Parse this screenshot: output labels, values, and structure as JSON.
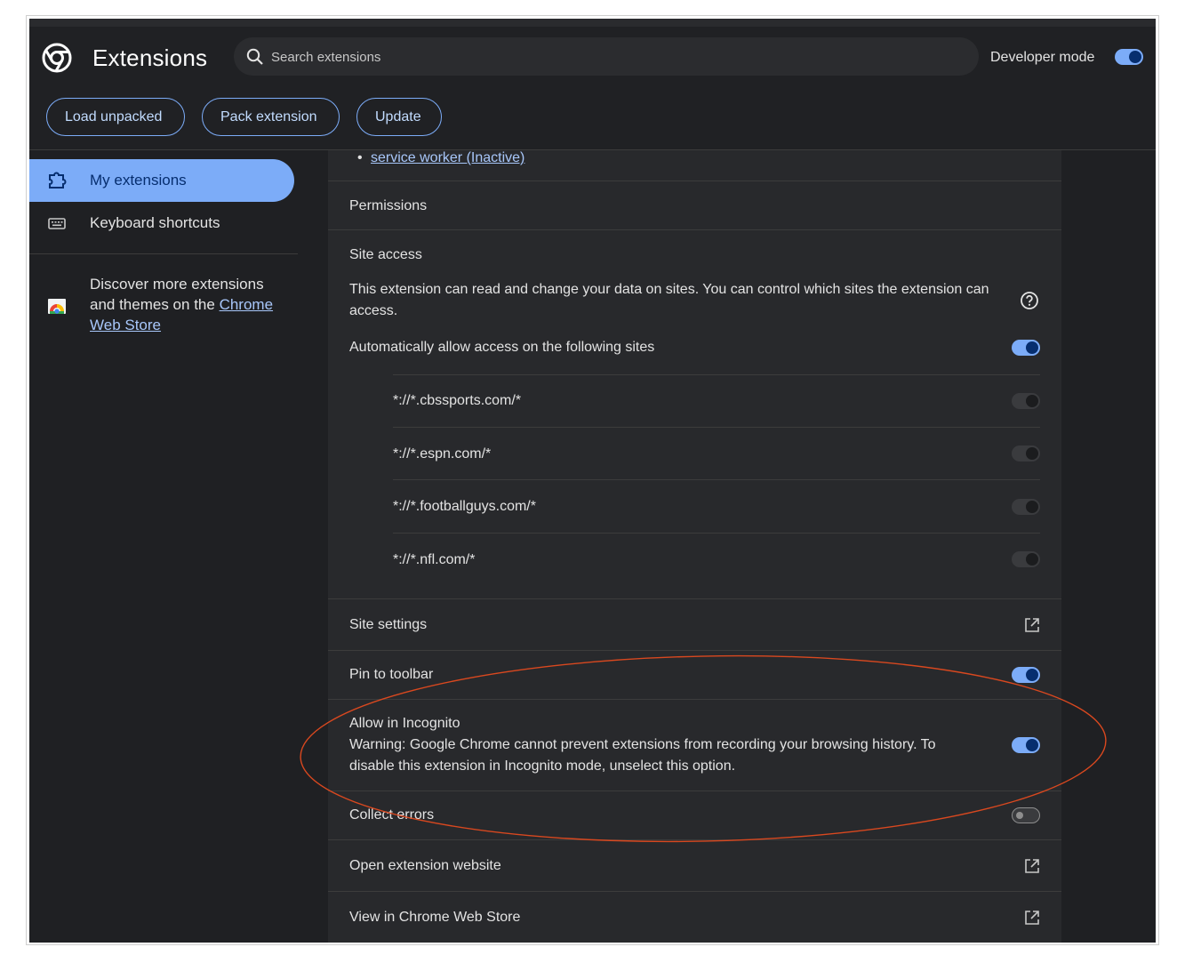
{
  "header": {
    "title": "Extensions",
    "search_placeholder": "Search extensions",
    "developer_mode_label": "Developer mode",
    "developer_mode_on": true
  },
  "toolbar": {
    "load_unpacked": "Load unpacked",
    "pack_extension": "Pack extension",
    "update": "Update"
  },
  "sidebar": {
    "items": [
      {
        "label": "My extensions",
        "active": true
      },
      {
        "label": "Keyboard shortcuts",
        "active": false
      }
    ],
    "promo_prefix_1": "Discover more extensions",
    "promo_prefix_2": "and themes on the",
    "promo_link": "Chrome Web Store"
  },
  "details": {
    "service_worker": "service worker (Inactive)",
    "permissions_label": "Permissions",
    "site_access_label": "Site access",
    "site_access_desc_line1": "This extension can read and change your data on sites. You can control which sites the extension can",
    "site_access_desc_line2": "access.",
    "auto_allow_label": "Automatically allow access on the following sites",
    "auto_allow_on": true,
    "sites": [
      {
        "pattern": "*://*.cbssports.com/*",
        "on": false
      },
      {
        "pattern": "*://*.espn.com/*",
        "on": false
      },
      {
        "pattern": "*://*.footballguys.com/*",
        "on": false
      },
      {
        "pattern": "*://*.nfl.com/*",
        "on": false
      }
    ],
    "site_settings_label": "Site settings",
    "pin_toolbar_label": "Pin to toolbar",
    "pin_toolbar_on": true,
    "incognito_label": "Allow in Incognito",
    "incognito_warning_line1": "Warning: Google Chrome cannot prevent extensions from recording your browsing history. To",
    "incognito_warning_line2": "disable this extension in Incognito mode, unselect this option.",
    "incognito_on": true,
    "collect_errors_label": "Collect errors",
    "collect_errors_on": false,
    "open_website_label": "Open extension website",
    "view_store_label": "View in Chrome Web Store"
  },
  "colors": {
    "accent": "#7cacf8",
    "annotation": "#d9481f",
    "background": "#1f2023",
    "panel": "#28292c"
  }
}
